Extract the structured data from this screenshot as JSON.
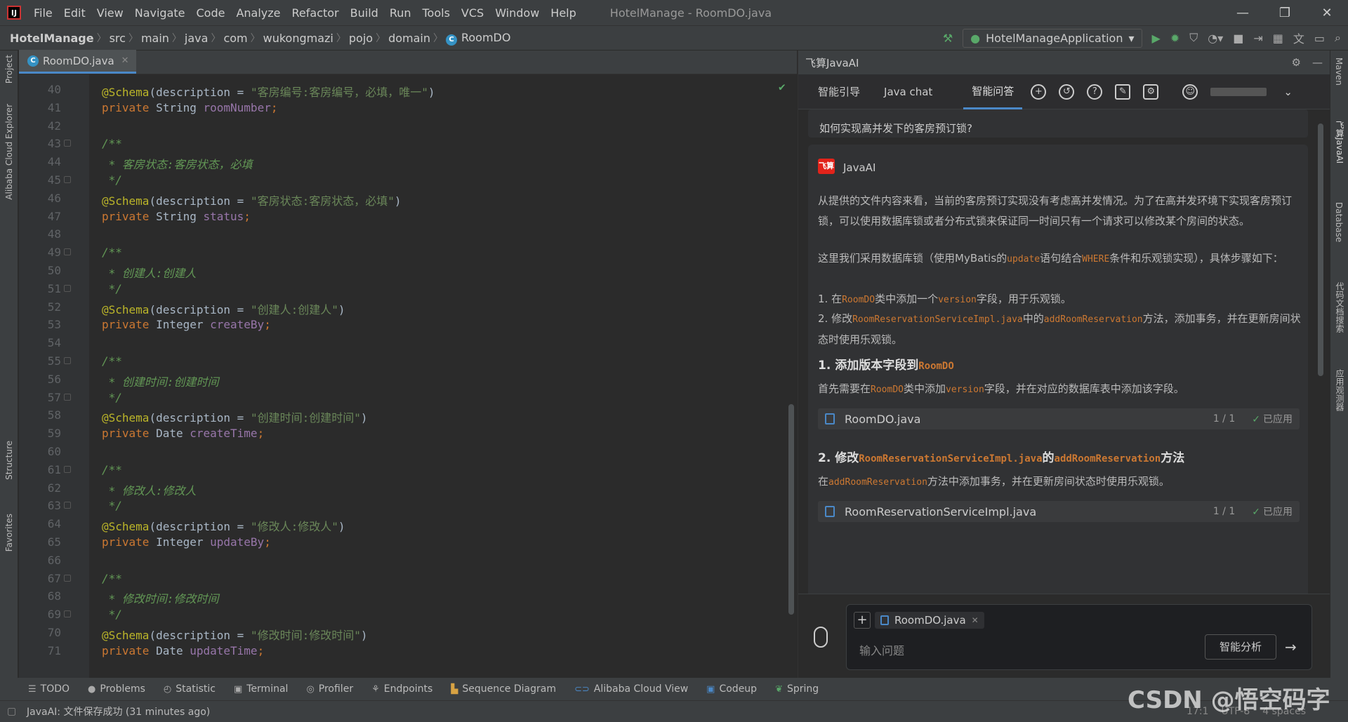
{
  "menubar": {
    "items": [
      "File",
      "Edit",
      "View",
      "Navigate",
      "Code",
      "Analyze",
      "Refactor",
      "Build",
      "Run",
      "Tools",
      "VCS",
      "Window",
      "Help"
    ],
    "window_title": "HotelManage - RoomDO.java"
  },
  "navbar": {
    "crumbs": [
      "HotelManage",
      "src",
      "main",
      "java",
      "com",
      "wukongmazi",
      "pojo",
      "domain",
      "RoomDO"
    ],
    "run_config": "HotelManageApplication"
  },
  "left_tools": {
    "project": "Project",
    "alibaba": "Alibaba Cloud Explorer",
    "structure": "Structure",
    "favorites": "Favorites"
  },
  "right_tools": {
    "maven": "Maven",
    "feisuan": "飞算JavaAI",
    "database": "Database",
    "search": "代码文档搜索",
    "monitor": "应用观测器"
  },
  "editor": {
    "tab_label": "RoomDO.java",
    "lines": [
      {
        "n": "40",
        "t": [
          [
            "an",
            "@Schema"
          ],
          [
            "",
            "(description = "
          ],
          [
            "st",
            "\"客房编号:客房编号，必填，唯一\""
          ],
          [
            "",
            ")"
          ]
        ]
      },
      {
        "n": "41",
        "t": [
          [
            "kw",
            "private "
          ],
          [
            "",
            "String "
          ],
          [
            "fd",
            "roomNumber"
          ],
          [
            "kw",
            ";"
          ]
        ]
      },
      {
        "n": "42",
        "t": []
      },
      {
        "n": "43",
        "t": [
          [
            "cm",
            "/**"
          ]
        ]
      },
      {
        "n": "44",
        "t": [
          [
            "cm",
            " * 客房状态:客房状态，必填"
          ]
        ]
      },
      {
        "n": "45",
        "t": [
          [
            "cm",
            " */"
          ]
        ]
      },
      {
        "n": "46",
        "t": [
          [
            "an",
            "@Schema"
          ],
          [
            "",
            "(description = "
          ],
          [
            "st",
            "\"客房状态:客房状态，必填\""
          ],
          [
            "",
            ")"
          ]
        ]
      },
      {
        "n": "47",
        "t": [
          [
            "kw",
            "private "
          ],
          [
            "",
            "String "
          ],
          [
            "fd",
            "status"
          ],
          [
            "kw",
            ";"
          ]
        ]
      },
      {
        "n": "48",
        "t": []
      },
      {
        "n": "49",
        "t": [
          [
            "cm",
            "/**"
          ]
        ]
      },
      {
        "n": "50",
        "t": [
          [
            "cm",
            " * 创建人:创建人"
          ]
        ]
      },
      {
        "n": "51",
        "t": [
          [
            "cm",
            " */"
          ]
        ]
      },
      {
        "n": "52",
        "t": [
          [
            "an",
            "@Schema"
          ],
          [
            "",
            "(description = "
          ],
          [
            "st",
            "\"创建人:创建人\""
          ],
          [
            "",
            ")"
          ]
        ]
      },
      {
        "n": "53",
        "t": [
          [
            "kw",
            "private "
          ],
          [
            "",
            "Integer "
          ],
          [
            "fd",
            "createBy"
          ],
          [
            "kw",
            ";"
          ]
        ]
      },
      {
        "n": "54",
        "t": []
      },
      {
        "n": "55",
        "t": [
          [
            "cm",
            "/**"
          ]
        ]
      },
      {
        "n": "56",
        "t": [
          [
            "cm",
            " * 创建时间:创建时间"
          ]
        ]
      },
      {
        "n": "57",
        "t": [
          [
            "cm",
            " */"
          ]
        ]
      },
      {
        "n": "58",
        "t": [
          [
            "an",
            "@Schema"
          ],
          [
            "",
            "(description = "
          ],
          [
            "st",
            "\"创建时间:创建时间\""
          ],
          [
            "",
            ")"
          ]
        ]
      },
      {
        "n": "59",
        "t": [
          [
            "kw",
            "private "
          ],
          [
            "",
            "Date "
          ],
          [
            "fd",
            "createTime"
          ],
          [
            "kw",
            ";"
          ]
        ]
      },
      {
        "n": "60",
        "t": []
      },
      {
        "n": "61",
        "t": [
          [
            "cm",
            "/**"
          ]
        ]
      },
      {
        "n": "62",
        "t": [
          [
            "cm",
            " * 修改人:修改人"
          ]
        ]
      },
      {
        "n": "63",
        "t": [
          [
            "cm",
            " */"
          ]
        ]
      },
      {
        "n": "64",
        "t": [
          [
            "an",
            "@Schema"
          ],
          [
            "",
            "(description = "
          ],
          [
            "st",
            "\"修改人:修改人\""
          ],
          [
            "",
            ")"
          ]
        ]
      },
      {
        "n": "65",
        "t": [
          [
            "kw",
            "private "
          ],
          [
            "",
            "Integer "
          ],
          [
            "fd",
            "updateBy"
          ],
          [
            "kw",
            ";"
          ]
        ]
      },
      {
        "n": "66",
        "t": []
      },
      {
        "n": "67",
        "t": [
          [
            "cm",
            "/**"
          ]
        ]
      },
      {
        "n": "68",
        "t": [
          [
            "cm",
            " * 修改时间:修改时间"
          ]
        ]
      },
      {
        "n": "69",
        "t": [
          [
            "cm",
            " */"
          ]
        ]
      },
      {
        "n": "70",
        "t": [
          [
            "an",
            "@Schema"
          ],
          [
            "",
            "(description = "
          ],
          [
            "st",
            "\"修改时间:修改时间\""
          ],
          [
            "",
            ")"
          ]
        ]
      },
      {
        "n": "71",
        "t": [
          [
            "kw",
            "private "
          ],
          [
            "",
            "Date "
          ],
          [
            "fd",
            "updateTime"
          ],
          [
            "kw",
            ";"
          ]
        ]
      }
    ]
  },
  "ai": {
    "panel_title": "飞算JavaAI",
    "tabs": [
      "智能引导",
      "Java chat",
      "智能问答"
    ],
    "question": "如何实现高并发下的客房预订锁?",
    "assistant_name": "JavaAI",
    "badge": "飞算",
    "p1": "从提供的文件内容来看，当前的客房预订实现没有考虑高并发情况。为了在高并发环境下实现客房预订锁，可以使用数据库锁或者分布式锁来保证同一时间只有一个请求可以修改某个房间的状态。",
    "p2a": "这里我们采用数据库锁（使用MyBatis的",
    "p2_code1": "update",
    "p2b": "语句结合",
    "p2_code2": "WHERE",
    "p2c": "条件和乐观锁实现），具体步骤如下：",
    "li1a": "1. 在",
    "li1_code1": "RoomDO",
    "li1b": "类中添加一个",
    "li1_code2": "version",
    "li1c": "字段，用于乐观锁。",
    "li2a": "2. 修改",
    "li2_code1": "RoomReservationServiceImpl.java",
    "li2b": "中的",
    "li2_code2": "addRoomReservation",
    "li2c": "方法，添加事务，并在更新房间状态时使用乐观锁。",
    "h1a": "1. 添加版本字段到",
    "h1_code": "RoomDO",
    "p3a": "首先需要在",
    "p3_code1": "RoomDO",
    "p3b": "类中添加",
    "p3_code2": "version",
    "p3c": "字段，并在对应的数据库表中添加该字段。",
    "file1": {
      "name": "RoomDO.java",
      "page": "1 / 1",
      "status": "已应用"
    },
    "h2a": "2. 修改",
    "h2_code1": "RoomReservationServiceImpl.java",
    "h2b": "的",
    "h2_code2": "addRoomReservation",
    "h2c": "方法",
    "p4a": "在",
    "p4_code": "addRoomReservation",
    "p4b": "方法中添加事务，并在更新房间状态时使用乐观锁。",
    "file2": {
      "name": "RoomReservationServiceImpl.java",
      "page": "1 / 1",
      "status": "已应用"
    },
    "chip": "RoomDO.java",
    "input_placeholder": "输入问题",
    "analyze_button": "智能分析"
  },
  "toolwindows": [
    "TODO",
    "Problems",
    "Statistic",
    "Terminal",
    "Profiler",
    "Endpoints",
    "Sequence Diagram",
    "Alibaba Cloud View",
    "Codeup",
    "Spring"
  ],
  "status": {
    "message": "JavaAI: 文件保存成功 (31 minutes ago)",
    "pos": "17:1",
    "encoding": "UTF-8",
    "indent": "4 spaces"
  },
  "watermark": "CSDN @悟空码字"
}
